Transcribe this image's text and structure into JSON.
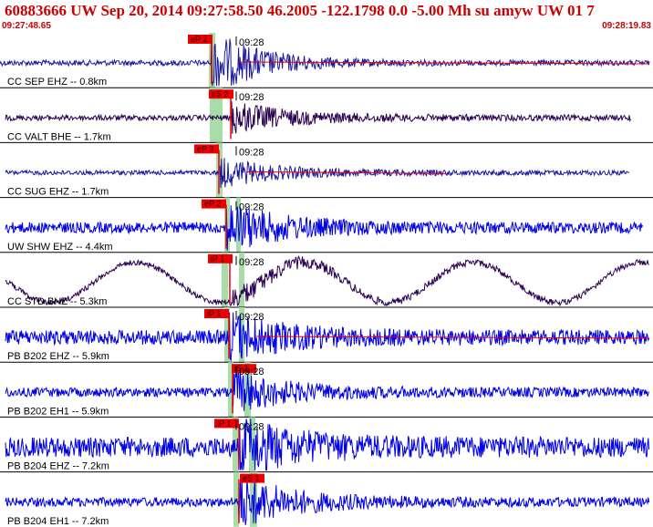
{
  "header": {
    "title": "60883666 UW Sep 20, 2014 09:27:58.50    46.2005 -122.1798  0.0 -5.00 Mh su amyw UW 01    7",
    "start_time": "09:27:48.65",
    "end_time": "09:28:19.83"
  },
  "colors": {
    "header_text": "#cc0000",
    "trace_blue": "#0000e6",
    "trace_dark": "#2a0050",
    "pick": "#ee0000",
    "window": "#a8dca8",
    "separator": "#000000"
  },
  "traces": [
    {
      "label": "CC SEP EHZ -- 0.8km",
      "pick": "eP 2",
      "tick": "09:28",
      "color": "dark_blue",
      "coda_line": true
    },
    {
      "label": "CC VALT BHE -- 1.7km",
      "pick": "eS 2",
      "tick": "09:28",
      "color": "dark_purple",
      "coda_line": false
    },
    {
      "label": "CC SUG EHZ -- 1.7km",
      "pick": "eP 3",
      "tick": "09:28",
      "color": "dark_blue",
      "coda_line": true
    },
    {
      "label": "UW SHW EHZ -- 4.4km",
      "pick": "eP 2",
      "tick": "09:28",
      "color": "blue",
      "coda_line": false
    },
    {
      "label": "CC STD BHZ -- 5.3km",
      "pick": "iP 1",
      "tick": "09:28",
      "color": "dark_purple",
      "coda_line": false
    },
    {
      "label": "PB B202 EHZ -- 5.9km",
      "pick": "iP 1",
      "tick": "09:28",
      "color": "blue",
      "coda_line": true
    },
    {
      "label": "PB B202 EH1 -- 5.9km",
      "pick": "iS 1",
      "tick": "09:28",
      "color": "blue",
      "coda_line": false
    },
    {
      "label": "PB B204 EHZ -- 7.2km",
      "pick": "iP 1",
      "tick": "09:28",
      "color": "blue",
      "coda_line": false
    },
    {
      "label": "PB B204 EH1 -- 7.2km",
      "pick": "eS 1",
      "tick": "",
      "color": "blue",
      "coda_line": false
    }
  ]
}
